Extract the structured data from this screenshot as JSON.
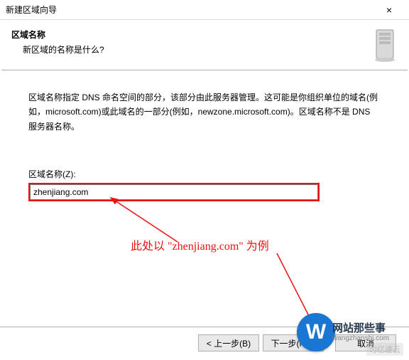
{
  "window": {
    "title": "新建区域向导",
    "close_icon": "×"
  },
  "header": {
    "title": "区域名称",
    "subtitle": "新区域的名称是什么?"
  },
  "description": "区域名称指定 DNS 命名空间的部分，该部分由此服务器管理。这可能是你组织单位的域名(例如，microsoft.com)或此域名的一部分(例如，newzone.microsoft.com)。区域名称不是 DNS 服务器名称。",
  "field": {
    "label": "区域名称(Z):",
    "value": "zhenjiang.com"
  },
  "annotation": "此处以 \"zhenjiang.com\" 为例",
  "buttons": {
    "back": "< 上一步(B)",
    "next": "下一步(N) >",
    "cancel": "取消"
  },
  "watermark": {
    "logo_letter": "W",
    "brand": "网站那些事",
    "domain": "wangzhanshi.com",
    "corner": "匀亿速云"
  }
}
